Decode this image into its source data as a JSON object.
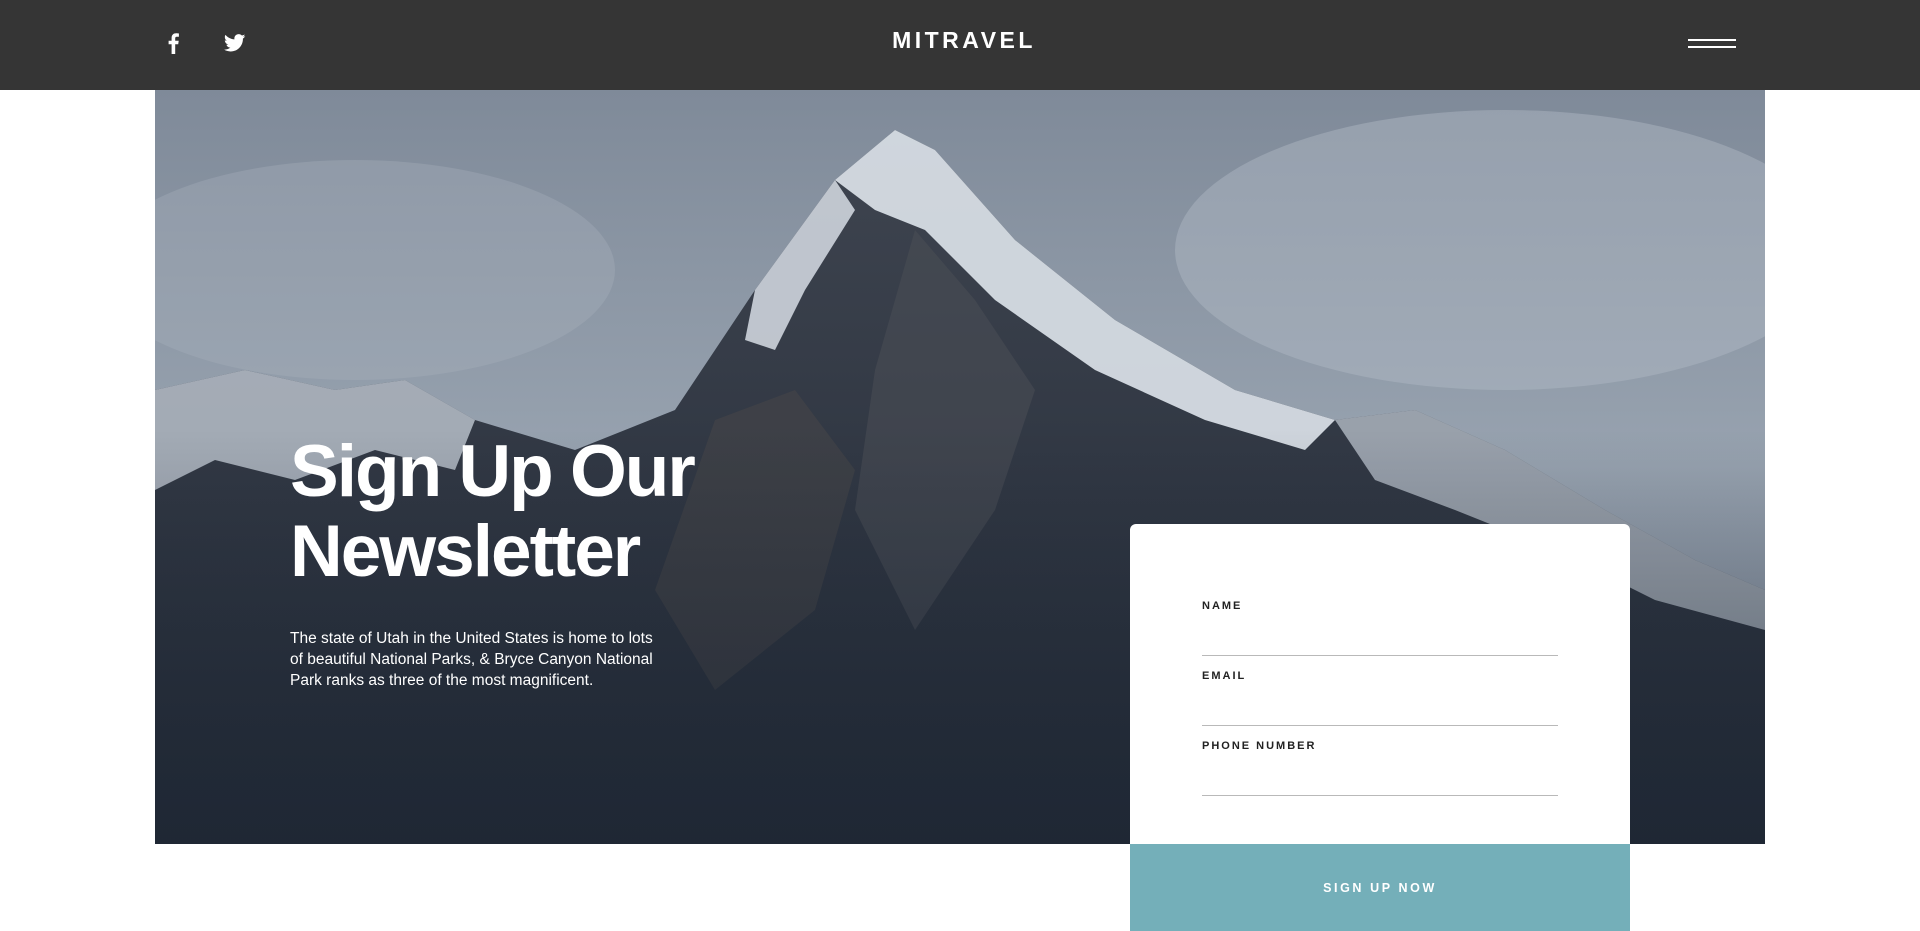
{
  "header": {
    "brand": "MITRAVEL",
    "social": [
      {
        "name": "facebook-icon"
      },
      {
        "name": "twitter-icon"
      }
    ],
    "menu_icon": "hamburger-menu-icon"
  },
  "hero": {
    "title_line1": "Sign Up Our",
    "title_line2": "Newsletter",
    "text": "The state of Utah in the United States is home to lots of beautiful National Parks, & Bryce Canyon National Park ranks as three of the most magnificent.",
    "image": "snowy-mountain-peak"
  },
  "form": {
    "name_label": "NAME",
    "email_label": "EMAIL",
    "phone_label": "PHONE NUMBER",
    "name_value": "",
    "email_value": "",
    "phone_value": "",
    "submit_label": "SIGN UP NOW"
  },
  "colors": {
    "topbar": "#353535",
    "accent": "#74afb9",
    "white": "#ffffff"
  }
}
